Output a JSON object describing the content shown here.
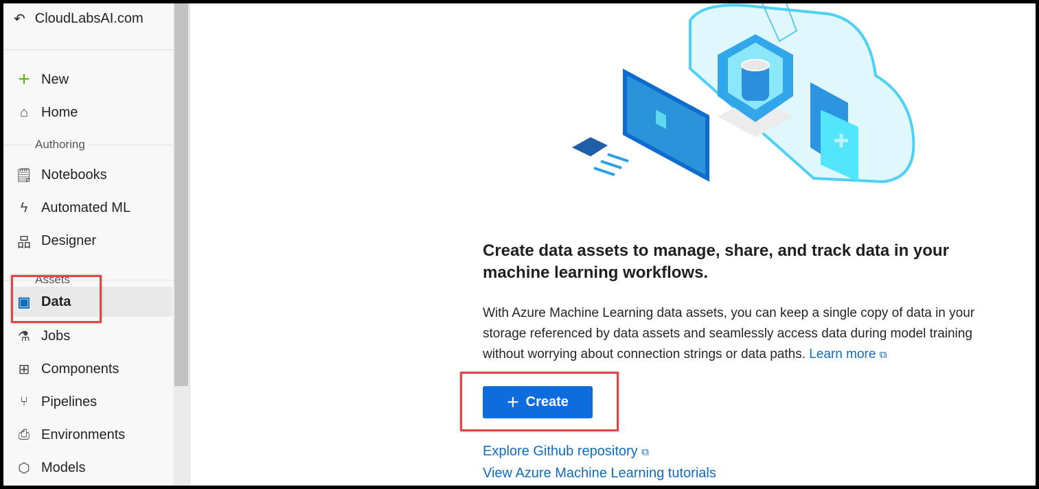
{
  "workspace": "CloudLabsAI.com",
  "nav": {
    "new": "New",
    "home": "Home",
    "authoring": "Authoring",
    "notebooks": "Notebooks",
    "automl": "Automated ML",
    "designer": "Designer",
    "assets": "Assets",
    "data": "Data",
    "jobs": "Jobs",
    "components": "Components",
    "pipelines": "Pipelines",
    "environments": "Environments",
    "models": "Models"
  },
  "main": {
    "heading": "Create data assets to manage, share, and track data in your machine learning workflows.",
    "body": "With Azure Machine Learning data assets, you can keep a single copy of data in your storage referenced by data assets and seamlessly access data during model training without worrying about connection strings or data paths.",
    "learn_more": "Learn more",
    "create": "Create",
    "github": "Explore Github repository",
    "tutorials": "View Azure Machine Learning tutorials"
  },
  "colors": {
    "accent": "#0f6cdd",
    "highlight": "#e04444"
  }
}
